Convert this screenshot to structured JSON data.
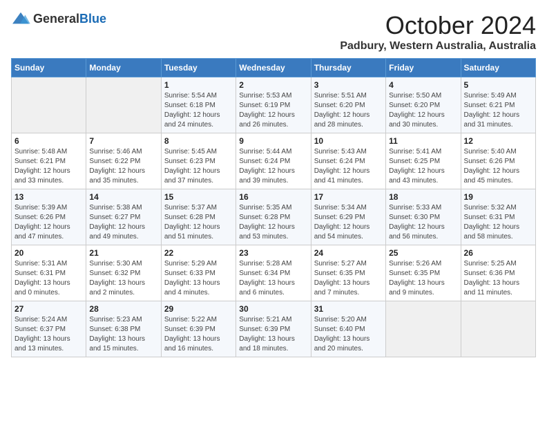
{
  "logo": {
    "general": "General",
    "blue": "Blue"
  },
  "header": {
    "month": "October 2024",
    "location": "Padbury, Western Australia, Australia"
  },
  "weekdays": [
    "Sunday",
    "Monday",
    "Tuesday",
    "Wednesday",
    "Thursday",
    "Friday",
    "Saturday"
  ],
  "weeks": [
    [
      {
        "day": "",
        "sunrise": "",
        "sunset": "",
        "daylight": ""
      },
      {
        "day": "",
        "sunrise": "",
        "sunset": "",
        "daylight": ""
      },
      {
        "day": "1",
        "sunrise": "Sunrise: 5:54 AM",
        "sunset": "Sunset: 6:18 PM",
        "daylight": "Daylight: 12 hours and 24 minutes."
      },
      {
        "day": "2",
        "sunrise": "Sunrise: 5:53 AM",
        "sunset": "Sunset: 6:19 PM",
        "daylight": "Daylight: 12 hours and 26 minutes."
      },
      {
        "day": "3",
        "sunrise": "Sunrise: 5:51 AM",
        "sunset": "Sunset: 6:20 PM",
        "daylight": "Daylight: 12 hours and 28 minutes."
      },
      {
        "day": "4",
        "sunrise": "Sunrise: 5:50 AM",
        "sunset": "Sunset: 6:20 PM",
        "daylight": "Daylight: 12 hours and 30 minutes."
      },
      {
        "day": "5",
        "sunrise": "Sunrise: 5:49 AM",
        "sunset": "Sunset: 6:21 PM",
        "daylight": "Daylight: 12 hours and 31 minutes."
      }
    ],
    [
      {
        "day": "6",
        "sunrise": "Sunrise: 5:48 AM",
        "sunset": "Sunset: 6:21 PM",
        "daylight": "Daylight: 12 hours and 33 minutes."
      },
      {
        "day": "7",
        "sunrise": "Sunrise: 5:46 AM",
        "sunset": "Sunset: 6:22 PM",
        "daylight": "Daylight: 12 hours and 35 minutes."
      },
      {
        "day": "8",
        "sunrise": "Sunrise: 5:45 AM",
        "sunset": "Sunset: 6:23 PM",
        "daylight": "Daylight: 12 hours and 37 minutes."
      },
      {
        "day": "9",
        "sunrise": "Sunrise: 5:44 AM",
        "sunset": "Sunset: 6:24 PM",
        "daylight": "Daylight: 12 hours and 39 minutes."
      },
      {
        "day": "10",
        "sunrise": "Sunrise: 5:43 AM",
        "sunset": "Sunset: 6:24 PM",
        "daylight": "Daylight: 12 hours and 41 minutes."
      },
      {
        "day": "11",
        "sunrise": "Sunrise: 5:41 AM",
        "sunset": "Sunset: 6:25 PM",
        "daylight": "Daylight: 12 hours and 43 minutes."
      },
      {
        "day": "12",
        "sunrise": "Sunrise: 5:40 AM",
        "sunset": "Sunset: 6:26 PM",
        "daylight": "Daylight: 12 hours and 45 minutes."
      }
    ],
    [
      {
        "day": "13",
        "sunrise": "Sunrise: 5:39 AM",
        "sunset": "Sunset: 6:26 PM",
        "daylight": "Daylight: 12 hours and 47 minutes."
      },
      {
        "day": "14",
        "sunrise": "Sunrise: 5:38 AM",
        "sunset": "Sunset: 6:27 PM",
        "daylight": "Daylight: 12 hours and 49 minutes."
      },
      {
        "day": "15",
        "sunrise": "Sunrise: 5:37 AM",
        "sunset": "Sunset: 6:28 PM",
        "daylight": "Daylight: 12 hours and 51 minutes."
      },
      {
        "day": "16",
        "sunrise": "Sunrise: 5:35 AM",
        "sunset": "Sunset: 6:28 PM",
        "daylight": "Daylight: 12 hours and 53 minutes."
      },
      {
        "day": "17",
        "sunrise": "Sunrise: 5:34 AM",
        "sunset": "Sunset: 6:29 PM",
        "daylight": "Daylight: 12 hours and 54 minutes."
      },
      {
        "day": "18",
        "sunrise": "Sunrise: 5:33 AM",
        "sunset": "Sunset: 6:30 PM",
        "daylight": "Daylight: 12 hours and 56 minutes."
      },
      {
        "day": "19",
        "sunrise": "Sunrise: 5:32 AM",
        "sunset": "Sunset: 6:31 PM",
        "daylight": "Daylight: 12 hours and 58 minutes."
      }
    ],
    [
      {
        "day": "20",
        "sunrise": "Sunrise: 5:31 AM",
        "sunset": "Sunset: 6:31 PM",
        "daylight": "Daylight: 13 hours and 0 minutes."
      },
      {
        "day": "21",
        "sunrise": "Sunrise: 5:30 AM",
        "sunset": "Sunset: 6:32 PM",
        "daylight": "Daylight: 13 hours and 2 minutes."
      },
      {
        "day": "22",
        "sunrise": "Sunrise: 5:29 AM",
        "sunset": "Sunset: 6:33 PM",
        "daylight": "Daylight: 13 hours and 4 minutes."
      },
      {
        "day": "23",
        "sunrise": "Sunrise: 5:28 AM",
        "sunset": "Sunset: 6:34 PM",
        "daylight": "Daylight: 13 hours and 6 minutes."
      },
      {
        "day": "24",
        "sunrise": "Sunrise: 5:27 AM",
        "sunset": "Sunset: 6:35 PM",
        "daylight": "Daylight: 13 hours and 7 minutes."
      },
      {
        "day": "25",
        "sunrise": "Sunrise: 5:26 AM",
        "sunset": "Sunset: 6:35 PM",
        "daylight": "Daylight: 13 hours and 9 minutes."
      },
      {
        "day": "26",
        "sunrise": "Sunrise: 5:25 AM",
        "sunset": "Sunset: 6:36 PM",
        "daylight": "Daylight: 13 hours and 11 minutes."
      }
    ],
    [
      {
        "day": "27",
        "sunrise": "Sunrise: 5:24 AM",
        "sunset": "Sunset: 6:37 PM",
        "daylight": "Daylight: 13 hours and 13 minutes."
      },
      {
        "day": "28",
        "sunrise": "Sunrise: 5:23 AM",
        "sunset": "Sunset: 6:38 PM",
        "daylight": "Daylight: 13 hours and 15 minutes."
      },
      {
        "day": "29",
        "sunrise": "Sunrise: 5:22 AM",
        "sunset": "Sunset: 6:39 PM",
        "daylight": "Daylight: 13 hours and 16 minutes."
      },
      {
        "day": "30",
        "sunrise": "Sunrise: 5:21 AM",
        "sunset": "Sunset: 6:39 PM",
        "daylight": "Daylight: 13 hours and 18 minutes."
      },
      {
        "day": "31",
        "sunrise": "Sunrise: 5:20 AM",
        "sunset": "Sunset: 6:40 PM",
        "daylight": "Daylight: 13 hours and 20 minutes."
      },
      {
        "day": "",
        "sunrise": "",
        "sunset": "",
        "daylight": ""
      },
      {
        "day": "",
        "sunrise": "",
        "sunset": "",
        "daylight": ""
      }
    ]
  ]
}
